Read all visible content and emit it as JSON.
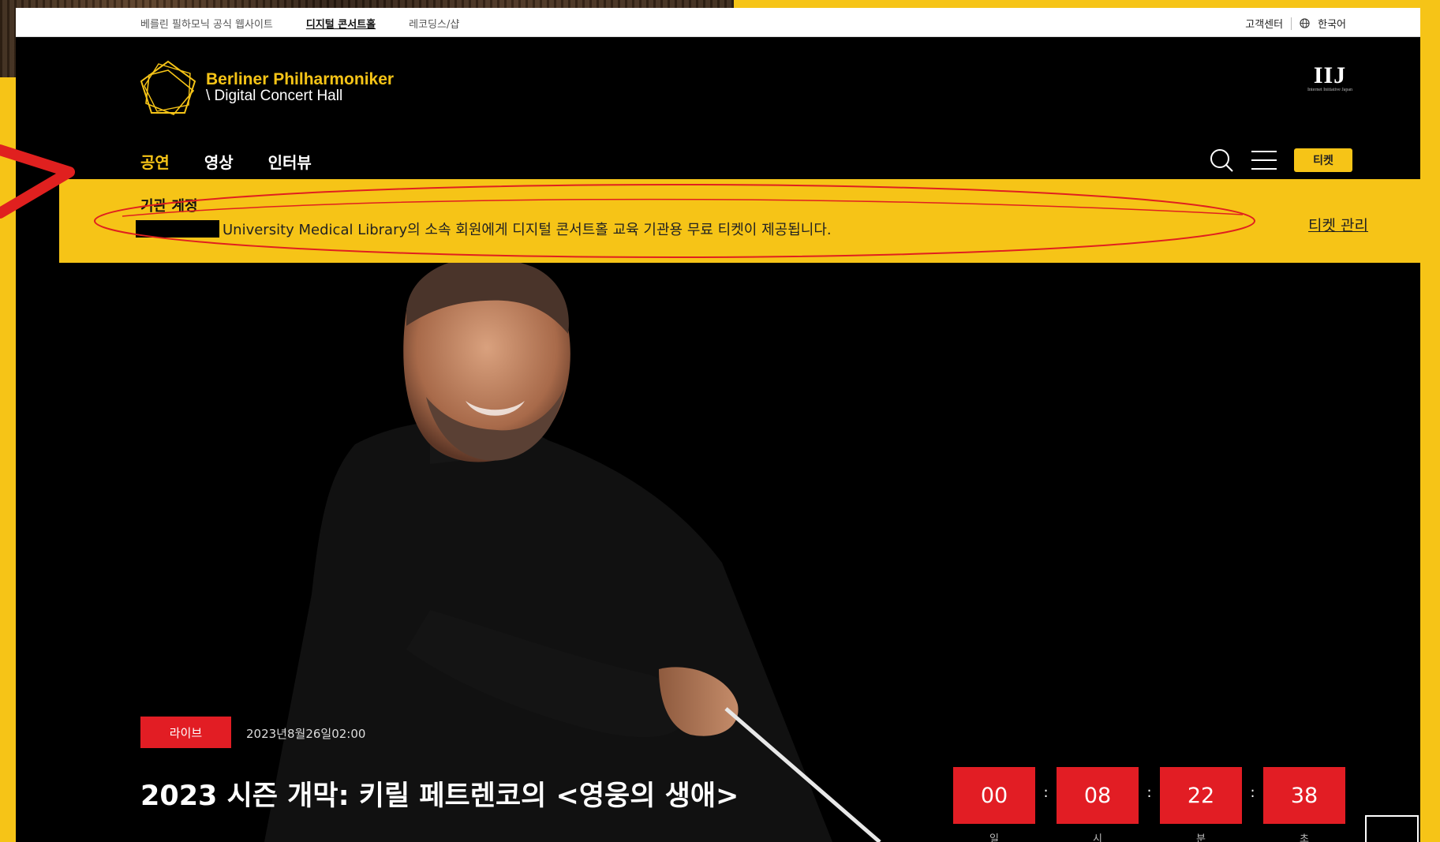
{
  "utility_bar": {
    "links": [
      "베를린 필하모닉 공식 웹사이트",
      "디지털 콘서트홀",
      "레코딩스/샵"
    ],
    "support": "고객센터",
    "language": "한국어"
  },
  "logo": {
    "line1": "Berliner Philharmoniker",
    "line2": "\\ Digital Concert Hall"
  },
  "sponsor": {
    "name": "IIJ",
    "tagline": "Internet Initiative Japan"
  },
  "nav": {
    "items": [
      "공연",
      "영상",
      "인터뷰"
    ],
    "active_index": 0
  },
  "header": {
    "ticket_label": "티켓"
  },
  "banner": {
    "title": "기관 계정",
    "message": "University Medical Library의 소속 회원에게 디지털 콘서트홀 교육 기관용 무료 티켓이 제공됩니다.",
    "link": "티켓 관리"
  },
  "event": {
    "badge": "라이브",
    "date": "2023년8월26일02:00",
    "title": "2023 시즌 개막: 키릴 페트렌코의 <영웅의 생애>"
  },
  "countdown": {
    "values": [
      "00",
      "08",
      "22",
      "38"
    ],
    "units": [
      "일",
      "시",
      "분",
      "초"
    ]
  },
  "colors": {
    "accent": "#f6c417",
    "live_red": "#e21d24",
    "annotation": "#e0201f"
  }
}
